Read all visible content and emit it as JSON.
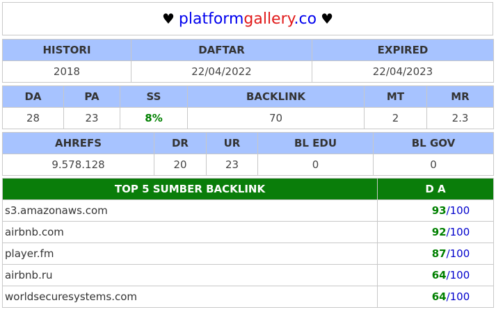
{
  "title": {
    "heart_left": "♥",
    "part1": "platform",
    "part2": "gallery",
    "part3": ".co",
    "heart_right": "♥"
  },
  "table1": {
    "headers": [
      "HISTORI",
      "DAFTAR",
      "EXPIRED"
    ],
    "values": [
      "2018",
      "22/04/2022",
      "22/04/2023"
    ]
  },
  "table2": {
    "headers": [
      "DA",
      "PA",
      "SS",
      "BACKLINK",
      "MT",
      "MR"
    ],
    "values": [
      "28",
      "23",
      "8%",
      "70",
      "2",
      "2.3"
    ]
  },
  "table3": {
    "headers": [
      "AHREFS",
      "DR",
      "UR",
      "BL EDU",
      "BL GOV"
    ],
    "values": [
      "9.578.128",
      "20",
      "23",
      "0",
      "0"
    ]
  },
  "backlinks": {
    "header_source": "TOP 5 SUMBER BACKLINK",
    "header_da": "D A",
    "rows": [
      {
        "domain": "s3.amazonaws.com",
        "da": "93",
        "sep": "/",
        "max": "100"
      },
      {
        "domain": "airbnb.com",
        "da": "92",
        "sep": "/",
        "max": "100"
      },
      {
        "domain": "player.fm",
        "da": "87",
        "sep": "/",
        "max": "100"
      },
      {
        "domain": "airbnb.ru",
        "da": "64",
        "sep": "/",
        "max": "100"
      },
      {
        "domain": "worldsecuresystems.com",
        "da": "64",
        "sep": "/",
        "max": "100"
      }
    ]
  },
  "colors": {
    "header_blue": "#a7c3ff",
    "header_green": "#0a7d0a",
    "ss_green": "#008000",
    "link_blue": "#0000ee",
    "brand_red": "#e11a1a"
  }
}
